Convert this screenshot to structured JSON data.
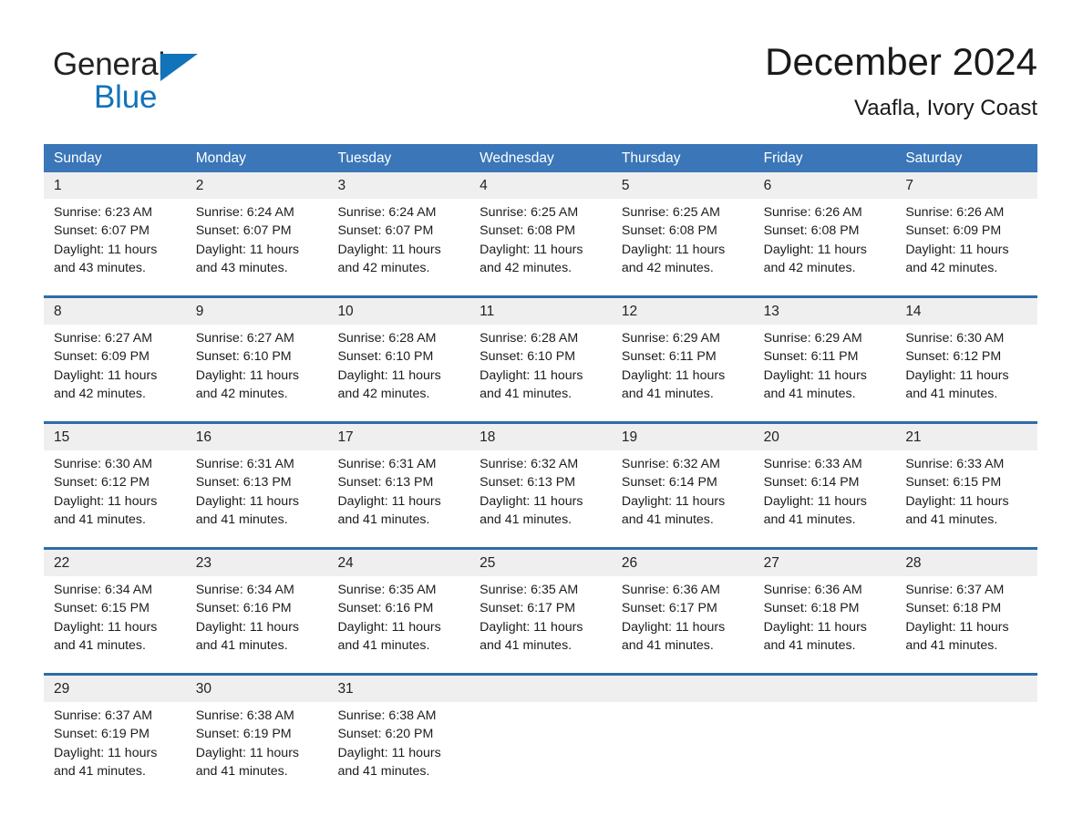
{
  "brand": {
    "name_part1": "General",
    "name_part2": "Blue",
    "triangle_color": "#1273ba"
  },
  "header": {
    "title": "December 2024",
    "subtitle": "Vaafla, Ivory Coast"
  },
  "theme": {
    "header_blue": "#3a76b8",
    "row_divider_blue": "#2e6da8",
    "daynum_band_gray": "#efefef"
  },
  "weekdays": [
    "Sunday",
    "Monday",
    "Tuesday",
    "Wednesday",
    "Thursday",
    "Friday",
    "Saturday"
  ],
  "weeks": [
    {
      "days": [
        {
          "num": "1",
          "sunrise": "Sunrise: 6:23 AM",
          "sunset": "Sunset: 6:07 PM",
          "daylight1": "Daylight: 11 hours",
          "daylight2": "and 43 minutes."
        },
        {
          "num": "2",
          "sunrise": "Sunrise: 6:24 AM",
          "sunset": "Sunset: 6:07 PM",
          "daylight1": "Daylight: 11 hours",
          "daylight2": "and 43 minutes."
        },
        {
          "num": "3",
          "sunrise": "Sunrise: 6:24 AM",
          "sunset": "Sunset: 6:07 PM",
          "daylight1": "Daylight: 11 hours",
          "daylight2": "and 42 minutes."
        },
        {
          "num": "4",
          "sunrise": "Sunrise: 6:25 AM",
          "sunset": "Sunset: 6:08 PM",
          "daylight1": "Daylight: 11 hours",
          "daylight2": "and 42 minutes."
        },
        {
          "num": "5",
          "sunrise": "Sunrise: 6:25 AM",
          "sunset": "Sunset: 6:08 PM",
          "daylight1": "Daylight: 11 hours",
          "daylight2": "and 42 minutes."
        },
        {
          "num": "6",
          "sunrise": "Sunrise: 6:26 AM",
          "sunset": "Sunset: 6:08 PM",
          "daylight1": "Daylight: 11 hours",
          "daylight2": "and 42 minutes."
        },
        {
          "num": "7",
          "sunrise": "Sunrise: 6:26 AM",
          "sunset": "Sunset: 6:09 PM",
          "daylight1": "Daylight: 11 hours",
          "daylight2": "and 42 minutes."
        }
      ]
    },
    {
      "days": [
        {
          "num": "8",
          "sunrise": "Sunrise: 6:27 AM",
          "sunset": "Sunset: 6:09 PM",
          "daylight1": "Daylight: 11 hours",
          "daylight2": "and 42 minutes."
        },
        {
          "num": "9",
          "sunrise": "Sunrise: 6:27 AM",
          "sunset": "Sunset: 6:10 PM",
          "daylight1": "Daylight: 11 hours",
          "daylight2": "and 42 minutes."
        },
        {
          "num": "10",
          "sunrise": "Sunrise: 6:28 AM",
          "sunset": "Sunset: 6:10 PM",
          "daylight1": "Daylight: 11 hours",
          "daylight2": "and 42 minutes."
        },
        {
          "num": "11",
          "sunrise": "Sunrise: 6:28 AM",
          "sunset": "Sunset: 6:10 PM",
          "daylight1": "Daylight: 11 hours",
          "daylight2": "and 41 minutes."
        },
        {
          "num": "12",
          "sunrise": "Sunrise: 6:29 AM",
          "sunset": "Sunset: 6:11 PM",
          "daylight1": "Daylight: 11 hours",
          "daylight2": "and 41 minutes."
        },
        {
          "num": "13",
          "sunrise": "Sunrise: 6:29 AM",
          "sunset": "Sunset: 6:11 PM",
          "daylight1": "Daylight: 11 hours",
          "daylight2": "and 41 minutes."
        },
        {
          "num": "14",
          "sunrise": "Sunrise: 6:30 AM",
          "sunset": "Sunset: 6:12 PM",
          "daylight1": "Daylight: 11 hours",
          "daylight2": "and 41 minutes."
        }
      ]
    },
    {
      "days": [
        {
          "num": "15",
          "sunrise": "Sunrise: 6:30 AM",
          "sunset": "Sunset: 6:12 PM",
          "daylight1": "Daylight: 11 hours",
          "daylight2": "and 41 minutes."
        },
        {
          "num": "16",
          "sunrise": "Sunrise: 6:31 AM",
          "sunset": "Sunset: 6:13 PM",
          "daylight1": "Daylight: 11 hours",
          "daylight2": "and 41 minutes."
        },
        {
          "num": "17",
          "sunrise": "Sunrise: 6:31 AM",
          "sunset": "Sunset: 6:13 PM",
          "daylight1": "Daylight: 11 hours",
          "daylight2": "and 41 minutes."
        },
        {
          "num": "18",
          "sunrise": "Sunrise: 6:32 AM",
          "sunset": "Sunset: 6:13 PM",
          "daylight1": "Daylight: 11 hours",
          "daylight2": "and 41 minutes."
        },
        {
          "num": "19",
          "sunrise": "Sunrise: 6:32 AM",
          "sunset": "Sunset: 6:14 PM",
          "daylight1": "Daylight: 11 hours",
          "daylight2": "and 41 minutes."
        },
        {
          "num": "20",
          "sunrise": "Sunrise: 6:33 AM",
          "sunset": "Sunset: 6:14 PM",
          "daylight1": "Daylight: 11 hours",
          "daylight2": "and 41 minutes."
        },
        {
          "num": "21",
          "sunrise": "Sunrise: 6:33 AM",
          "sunset": "Sunset: 6:15 PM",
          "daylight1": "Daylight: 11 hours",
          "daylight2": "and 41 minutes."
        }
      ]
    },
    {
      "days": [
        {
          "num": "22",
          "sunrise": "Sunrise: 6:34 AM",
          "sunset": "Sunset: 6:15 PM",
          "daylight1": "Daylight: 11 hours",
          "daylight2": "and 41 minutes."
        },
        {
          "num": "23",
          "sunrise": "Sunrise: 6:34 AM",
          "sunset": "Sunset: 6:16 PM",
          "daylight1": "Daylight: 11 hours",
          "daylight2": "and 41 minutes."
        },
        {
          "num": "24",
          "sunrise": "Sunrise: 6:35 AM",
          "sunset": "Sunset: 6:16 PM",
          "daylight1": "Daylight: 11 hours",
          "daylight2": "and 41 minutes."
        },
        {
          "num": "25",
          "sunrise": "Sunrise: 6:35 AM",
          "sunset": "Sunset: 6:17 PM",
          "daylight1": "Daylight: 11 hours",
          "daylight2": "and 41 minutes."
        },
        {
          "num": "26",
          "sunrise": "Sunrise: 6:36 AM",
          "sunset": "Sunset: 6:17 PM",
          "daylight1": "Daylight: 11 hours",
          "daylight2": "and 41 minutes."
        },
        {
          "num": "27",
          "sunrise": "Sunrise: 6:36 AM",
          "sunset": "Sunset: 6:18 PM",
          "daylight1": "Daylight: 11 hours",
          "daylight2": "and 41 minutes."
        },
        {
          "num": "28",
          "sunrise": "Sunrise: 6:37 AM",
          "sunset": "Sunset: 6:18 PM",
          "daylight1": "Daylight: 11 hours",
          "daylight2": "and 41 minutes."
        }
      ]
    },
    {
      "days": [
        {
          "num": "29",
          "sunrise": "Sunrise: 6:37 AM",
          "sunset": "Sunset: 6:19 PM",
          "daylight1": "Daylight: 11 hours",
          "daylight2": "and 41 minutes."
        },
        {
          "num": "30",
          "sunrise": "Sunrise: 6:38 AM",
          "sunset": "Sunset: 6:19 PM",
          "daylight1": "Daylight: 11 hours",
          "daylight2": "and 41 minutes."
        },
        {
          "num": "31",
          "sunrise": "Sunrise: 6:38 AM",
          "sunset": "Sunset: 6:20 PM",
          "daylight1": "Daylight: 11 hours",
          "daylight2": "and 41 minutes."
        },
        {
          "num": "",
          "sunrise": "",
          "sunset": "",
          "daylight1": "",
          "daylight2": ""
        },
        {
          "num": "",
          "sunrise": "",
          "sunset": "",
          "daylight1": "",
          "daylight2": ""
        },
        {
          "num": "",
          "sunrise": "",
          "sunset": "",
          "daylight1": "",
          "daylight2": ""
        },
        {
          "num": "",
          "sunrise": "",
          "sunset": "",
          "daylight1": "",
          "daylight2": ""
        }
      ]
    }
  ]
}
